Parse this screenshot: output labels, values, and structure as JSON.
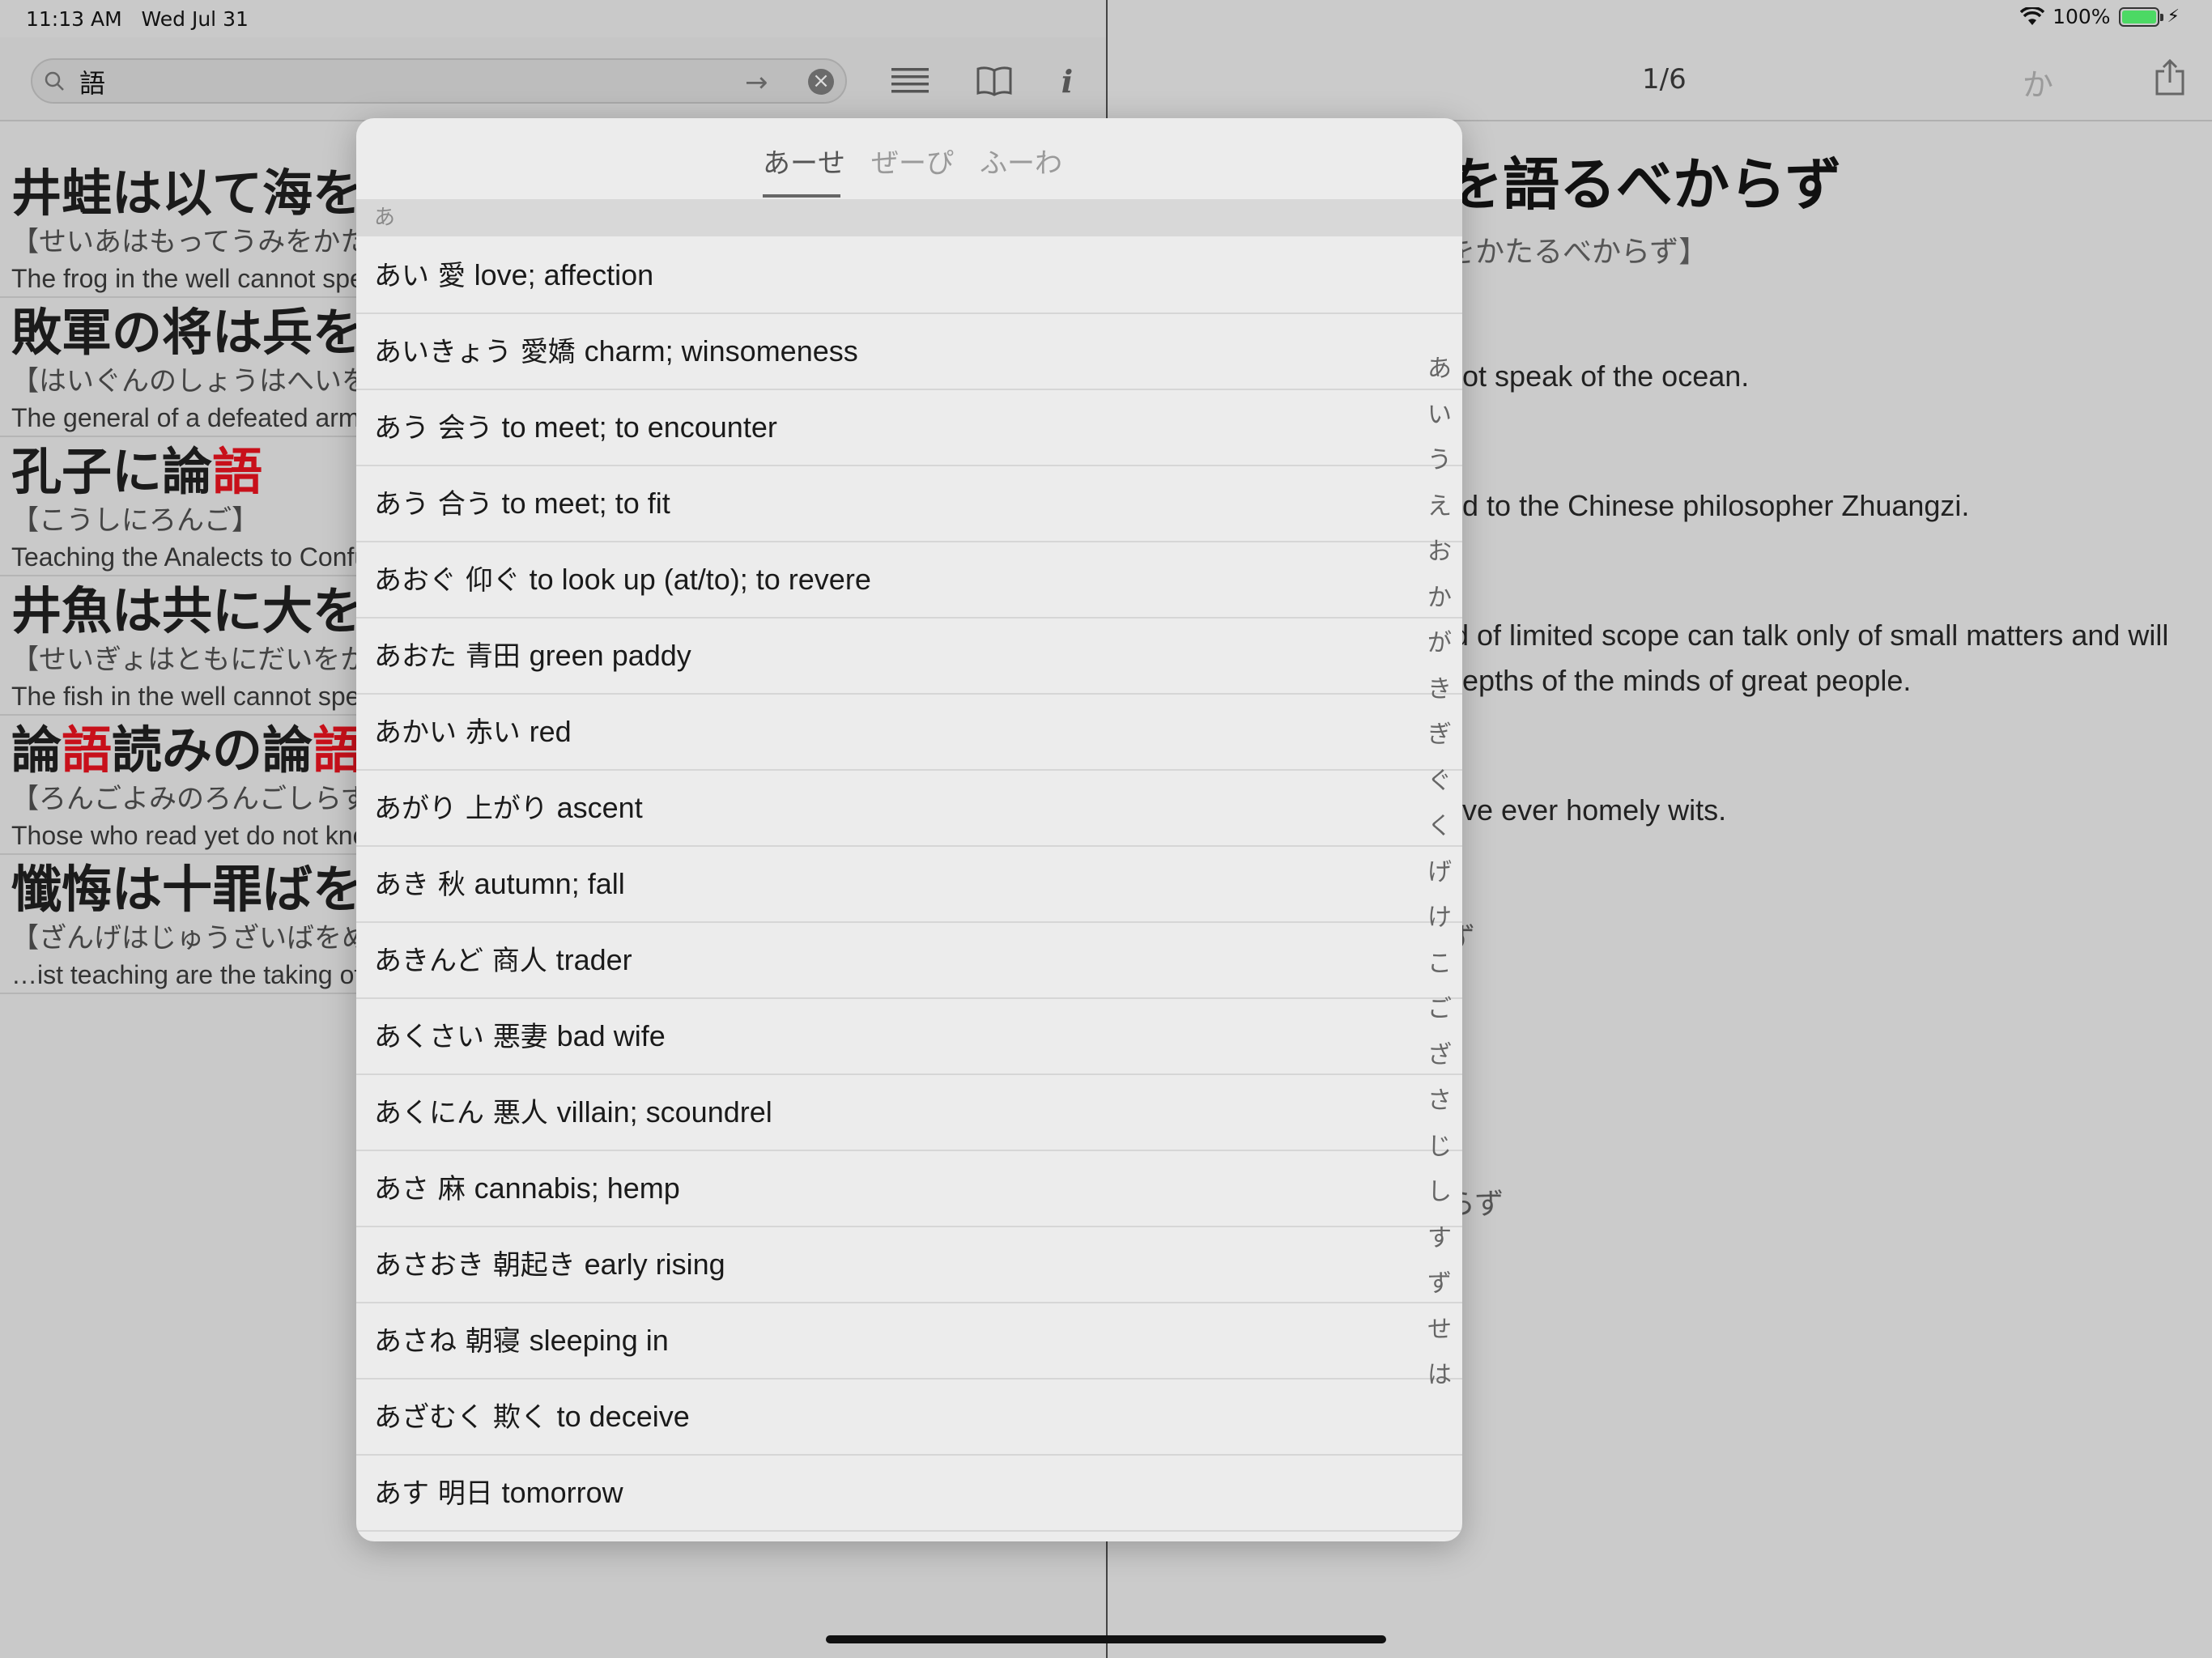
{
  "status": {
    "time": "11:13 AM",
    "date": "Wed Jul 31",
    "battery": "100%",
    "battery_level": 1.0
  },
  "search": {
    "value": "語",
    "arrow": "→"
  },
  "left_results": [
    {
      "title_before": "井蛙は以て海を",
      "title_hl": "",
      "title_after": "",
      "reading": "【せいあはもってうみをかた",
      "english": "The frog in the well cannot speak"
    },
    {
      "title_before": "敗軍の将は兵を",
      "title_hl": "",
      "title_after": "",
      "reading": "【はいぐんのしょうはへいを",
      "english": "The general of a defeated army"
    },
    {
      "title_before": "孔子に論",
      "title_hl": "語",
      "title_after": "",
      "reading": "【こうしにろんご】",
      "english": "Teaching the Analects to Confucius"
    },
    {
      "title_before": "井魚は共に大を",
      "title_hl": "",
      "title_after": "",
      "reading": "【せいぎょはともにだいをか",
      "english": "The fish in the well cannot speak"
    },
    {
      "title_before": "論",
      "title_hl": "語",
      "title_after": "読みの論",
      "title_hl2": "語",
      "reading": "【ろんごよみのろんごしらず",
      "english": "Those who read yet do not know"
    },
    {
      "title_before": "懺悔は十罪ばを",
      "title_hl": "",
      "title_after": "",
      "reading": "【ざんげはじゅうざいばをめ",
      "english": "…ist teaching are the taking of"
    }
  ],
  "right": {
    "counter": "1/6",
    "kana_button": "か",
    "title": "を語るべからず",
    "reading": "をかたるべからず】",
    "line1": "not speak of the ocean.",
    "line2": "ed to the Chinese philosopher Zhuangzi.",
    "line3": "ld of limited scope can talk only of small matters and will",
    "line4": "depths of the minds of great people.",
    "line5": "ave ever homely wits.",
    "line6": "ず",
    "line7": "らず"
  },
  "popover": {
    "tabs": [
      "あーせ",
      "ぜーぴ",
      "ふーわ"
    ],
    "section": "あ",
    "entries": [
      {
        "kana": "あい",
        "kanji": "愛",
        "meaning": "love; affection"
      },
      {
        "kana": "あいきょう",
        "kanji": "愛嬌",
        "meaning": "charm; winsomeness"
      },
      {
        "kana": "あう",
        "kanji": "会う",
        "meaning": "to meet; to encounter"
      },
      {
        "kana": "あう",
        "kanji": "合う",
        "meaning": "to meet; to fit"
      },
      {
        "kana": "あおぐ",
        "kanji": "仰ぐ",
        "meaning": "to look up (at/to); to revere"
      },
      {
        "kana": "あおた",
        "kanji": "青田",
        "meaning": "green paddy"
      },
      {
        "kana": "あかい",
        "kanji": "赤い",
        "meaning": "red"
      },
      {
        "kana": "あがり",
        "kanji": "上がり",
        "meaning": "ascent"
      },
      {
        "kana": "あき",
        "kanji": "秋",
        "meaning": "autumn; fall"
      },
      {
        "kana": "あきんど",
        "kanji": "商人",
        "meaning": "trader"
      },
      {
        "kana": "あくさい",
        "kanji": "悪妻",
        "meaning": "bad wife"
      },
      {
        "kana": "あくにん",
        "kanji": "悪人",
        "meaning": "villain; scoundrel"
      },
      {
        "kana": "あさ",
        "kanji": "麻",
        "meaning": "cannabis; hemp"
      },
      {
        "kana": "あさおき",
        "kanji": "朝起き",
        "meaning": "early rising"
      },
      {
        "kana": "あさね",
        "kanji": "朝寝",
        "meaning": "sleeping in"
      },
      {
        "kana": "あざむく",
        "kanji": "欺く",
        "meaning": "to deceive"
      },
      {
        "kana": "あす",
        "kanji": "明日",
        "meaning": "tomorrow"
      }
    ],
    "index": [
      "あ",
      "い",
      "う",
      "え",
      "お",
      "か",
      "が",
      "き",
      "ぎ",
      "ぐ",
      "く",
      "げ",
      "け",
      "こ",
      "ご",
      "ざ",
      "さ",
      "じ",
      "し",
      "す",
      "ず",
      "せ",
      "は"
    ]
  }
}
